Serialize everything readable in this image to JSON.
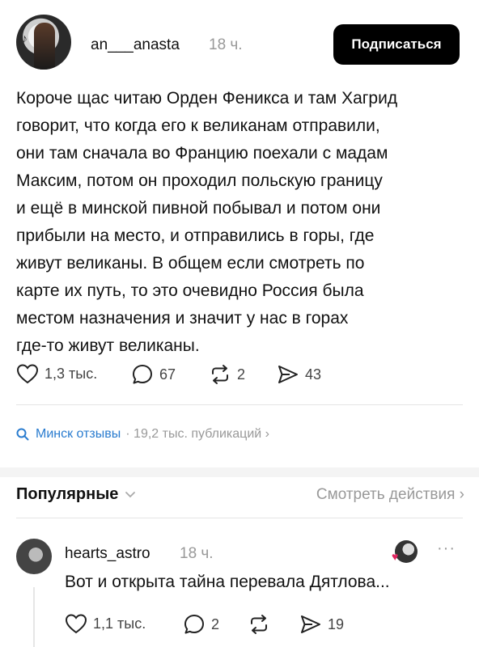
{
  "post": {
    "username": "an___anasta",
    "time": "18 ч.",
    "subscribe_label": "Подписаться",
    "text_lines": [
      "Короче щас читаю Орден Феникса и там Хагрид",
      "говорит, что когда его к великанам отправили,",
      "они там сначала во Францию поехали с мадам",
      "Максим, потом он проходил польскую границу",
      "и ещё в минской пивной побывал и потом они",
      "прибыли на место, и отправились в горы, где",
      "живут великаны. В общем если смотреть по",
      "карте их путь, то это очевидно Россия была",
      "местом назначения и значит у нас в горах",
      "где-то живут великаны."
    ],
    "likes": "1,3 тыс.",
    "comments": "67",
    "reposts": "2",
    "shares": "43"
  },
  "topic": {
    "name": "Минск отзывы",
    "meta": "· 19,2 тыс. публикаций ›"
  },
  "sort": {
    "label": "Популярные",
    "view_activity": "Смотреть действия ›"
  },
  "reply": {
    "username": "hearts_astro",
    "time": "18 ч.",
    "text": "Вот и открыта тайна перевала Дятлова...",
    "likes": "1,1 тыс.",
    "comments": "2",
    "reposts": "",
    "shares": "19"
  },
  "colors": {
    "accent_link": "#2a7ccf",
    "muted": "#999999",
    "button_bg": "#000000",
    "heart": "#e0245e"
  }
}
